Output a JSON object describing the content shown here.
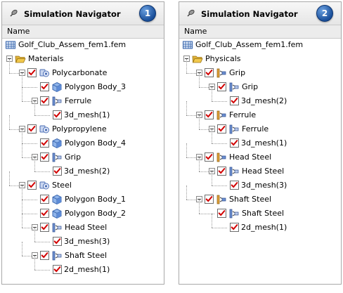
{
  "panels": [
    {
      "title": "Simulation Navigator",
      "badge": "1",
      "column_header": "Name",
      "rows": [
        {
          "level": 0,
          "icon": "fem-file-icon",
          "label": "Golf_Club_Assem_fem1.fem",
          "expander": false,
          "checkbox": false
        },
        {
          "level": 1,
          "icon": "folder-open-icon",
          "label": "Materials",
          "expander": true,
          "checkbox": false
        },
        {
          "level": 2,
          "icon": "material-icon",
          "label": "Polycarbonate",
          "expander": true,
          "checkbox": true
        },
        {
          "level": 3,
          "icon": "polygon-body-icon",
          "label": "Polygon Body_3",
          "expander": false,
          "checkbox": true
        },
        {
          "level": 3,
          "icon": "mesh-collector-icon",
          "label": "Ferrule",
          "expander": true,
          "checkbox": true
        },
        {
          "level": 4,
          "icon": "",
          "label": "3d_mesh(1)",
          "expander": false,
          "checkbox": true
        },
        {
          "level": 2,
          "icon": "material-icon",
          "label": "Polypropylene",
          "expander": true,
          "checkbox": true
        },
        {
          "level": 3,
          "icon": "polygon-body-icon",
          "label": "Polygon Body_4",
          "expander": false,
          "checkbox": true
        },
        {
          "level": 3,
          "icon": "mesh-collector-icon",
          "label": "Grip",
          "expander": true,
          "checkbox": true
        },
        {
          "level": 4,
          "icon": "",
          "label": "3d_mesh(2)",
          "expander": false,
          "checkbox": true
        },
        {
          "level": 2,
          "icon": "material-icon",
          "label": "Steel",
          "expander": true,
          "checkbox": true
        },
        {
          "level": 3,
          "icon": "polygon-body-icon",
          "label": "Polygon Body_1",
          "expander": false,
          "checkbox": true
        },
        {
          "level": 3,
          "icon": "polygon-body-icon",
          "label": "Polygon Body_2",
          "expander": false,
          "checkbox": true
        },
        {
          "level": 3,
          "icon": "mesh-collector-icon",
          "label": "Head Steel",
          "expander": true,
          "checkbox": true
        },
        {
          "level": 4,
          "icon": "",
          "label": "3d_mesh(3)",
          "expander": false,
          "checkbox": true
        },
        {
          "level": 3,
          "icon": "mesh-collector-icon",
          "label": "Shaft Steel",
          "expander": true,
          "checkbox": true
        },
        {
          "level": 4,
          "icon": "",
          "label": "2d_mesh(1)",
          "expander": false,
          "checkbox": true
        }
      ]
    },
    {
      "title": "Simulation Navigator",
      "badge": "2",
      "column_header": "Name",
      "rows": [
        {
          "level": 0,
          "icon": "fem-file-icon",
          "label": "Golf_Club_Assem_fem1.fem",
          "expander": false,
          "checkbox": false
        },
        {
          "level": 1,
          "icon": "folder-open-icon",
          "label": "Physicals",
          "expander": true,
          "checkbox": false
        },
        {
          "level": 2,
          "icon": "physical-property-icon",
          "label": "Grip",
          "expander": true,
          "checkbox": true
        },
        {
          "level": 3,
          "icon": "mesh-collector-icon",
          "label": "Grip",
          "expander": true,
          "checkbox": true
        },
        {
          "level": 4,
          "icon": "",
          "label": "3d_mesh(2)",
          "expander": false,
          "checkbox": true
        },
        {
          "level": 2,
          "icon": "physical-property-icon",
          "label": "Ferrule",
          "expander": true,
          "checkbox": true
        },
        {
          "level": 3,
          "icon": "mesh-collector-icon",
          "label": "Ferrule",
          "expander": true,
          "checkbox": true
        },
        {
          "level": 4,
          "icon": "",
          "label": "3d_mesh(1)",
          "expander": false,
          "checkbox": true
        },
        {
          "level": 2,
          "icon": "physical-property-icon",
          "label": "Head Steel",
          "expander": true,
          "checkbox": true
        },
        {
          "level": 3,
          "icon": "mesh-collector-icon",
          "label": "Head Steel",
          "expander": true,
          "checkbox": true
        },
        {
          "level": 4,
          "icon": "",
          "label": "3d_mesh(3)",
          "expander": false,
          "checkbox": true
        },
        {
          "level": 2,
          "icon": "physical-property-icon",
          "label": "Shaft Steel",
          "expander": true,
          "checkbox": true
        },
        {
          "level": 3,
          "icon": "mesh-collector-icon",
          "label": "Shaft Steel",
          "expander": false,
          "checkbox": true
        },
        {
          "level": 4,
          "icon": "",
          "label": "2d_mesh(1)",
          "expander": false,
          "checkbox": true
        }
      ]
    }
  ],
  "colors": {
    "check": "#d10000",
    "badge": "#1a4f9a",
    "folder": "#f2c94c"
  }
}
